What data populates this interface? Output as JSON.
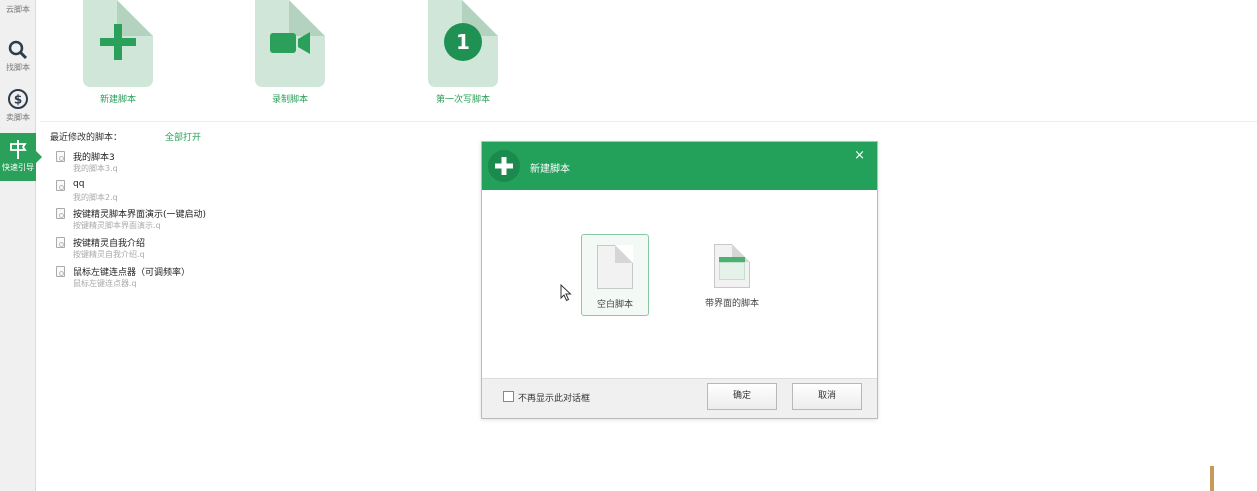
{
  "sidebar": {
    "items": [
      {
        "label": "云脚本",
        "icon": "cloud-icon"
      },
      {
        "label": "找脚本",
        "icon": "search-icon"
      },
      {
        "label": "卖脚本",
        "icon": "dollar-coin-icon"
      },
      {
        "label": "快速引导",
        "icon": "signpost-icon",
        "active": true
      }
    ]
  },
  "tiles": [
    {
      "label": "新建脚本",
      "icon": "plus-icon"
    },
    {
      "label": "录制脚本",
      "icon": "video-camera-icon"
    },
    {
      "label": "第一次写脚本",
      "icon": "number-one-icon",
      "number": "1"
    }
  ],
  "recent": {
    "header": "最近修改的脚本：",
    "open_all": "全部打开",
    "items": [
      {
        "title": "我的脚本3",
        "sub": "我的脚本3.q"
      },
      {
        "title": "qq",
        "sub": "我的脚本2.q"
      },
      {
        "title": "按键精灵脚本界面演示(一键启动)",
        "sub": "按键精灵脚本界面演示.q"
      },
      {
        "title": "按键精灵自我介绍",
        "sub": "按键精灵自我介绍.q"
      },
      {
        "title": "鼠标左键连点器（可调频率）",
        "sub": "鼠标左键连点器.q"
      }
    ]
  },
  "dialog": {
    "title": "新建脚本",
    "close": "×",
    "options": [
      {
        "label": "空白脚本",
        "selected": true
      },
      {
        "label": "带界面的脚本",
        "selected": false
      }
    ],
    "checkbox_label": "不再显示此对话框",
    "ok": "确定",
    "cancel": "取消"
  },
  "colors": {
    "accent": "#23a05a",
    "tile_bg": "#cfe6d8",
    "tile_icon": "#2aa05a"
  }
}
